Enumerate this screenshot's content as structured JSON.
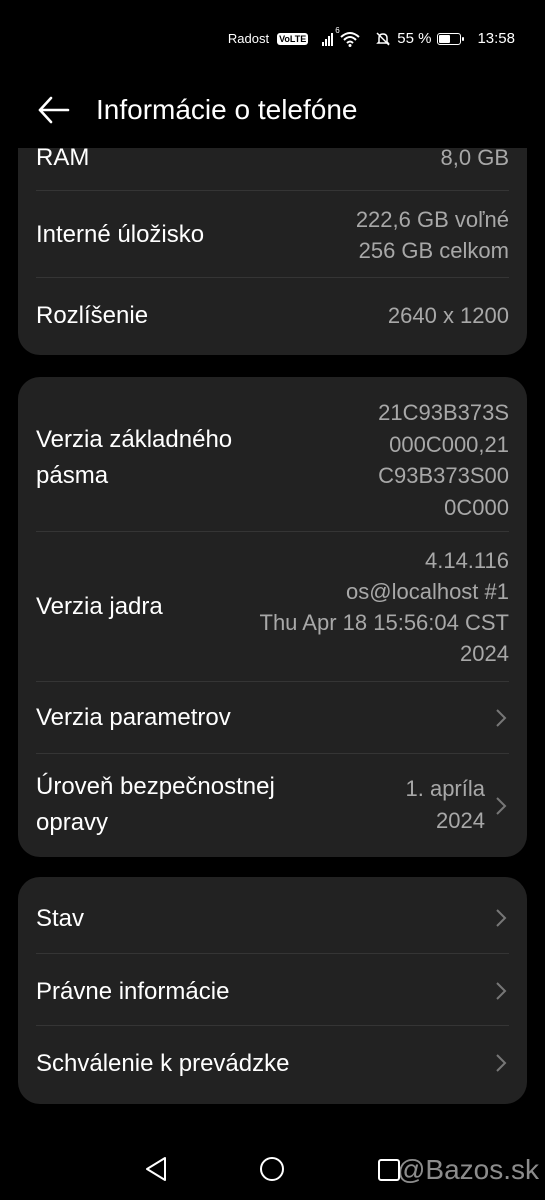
{
  "status_bar": {
    "carrier": "Radost",
    "volte": "VoLTE",
    "wifi_label": "6",
    "battery_percent": 55,
    "battery_text": "55 %",
    "time": "13:58"
  },
  "header": {
    "title": "Informácie o telefóne"
  },
  "card1": {
    "ram": {
      "label": "RAM",
      "value": "8,0 GB"
    },
    "storage": {
      "label": "Interné úložisko",
      "value_line1": "222,6  GB voľné",
      "value_line2": "256  GB celkom"
    },
    "resolution": {
      "label": "Rozlíšenie",
      "value": "2640 x 1200"
    }
  },
  "card2": {
    "baseband": {
      "label_line1": "Verzia základného",
      "label_line2": "pásma",
      "value_lines": [
        "21C93B373S",
        "000C000,21",
        "C93B373S00",
        "0C000"
      ]
    },
    "kernel": {
      "label": "Verzia jadra",
      "value_lines": [
        "4.14.116",
        "os@localhost #1",
        "Thu Apr 18 15:56:04 CST",
        "2024"
      ]
    },
    "params": {
      "label": "Verzia parametrov"
    },
    "security": {
      "label_line1": "Úroveň bezpečnostnej",
      "label_line2": "opravy",
      "value_line1": "1. apríla",
      "value_line2": "2024"
    }
  },
  "card3": {
    "status": {
      "label": "Stav"
    },
    "legal": {
      "label": "Právne informácie"
    },
    "approval": {
      "label": "Schválenie k prevádzke"
    }
  },
  "watermark": "@Bazos.sk"
}
